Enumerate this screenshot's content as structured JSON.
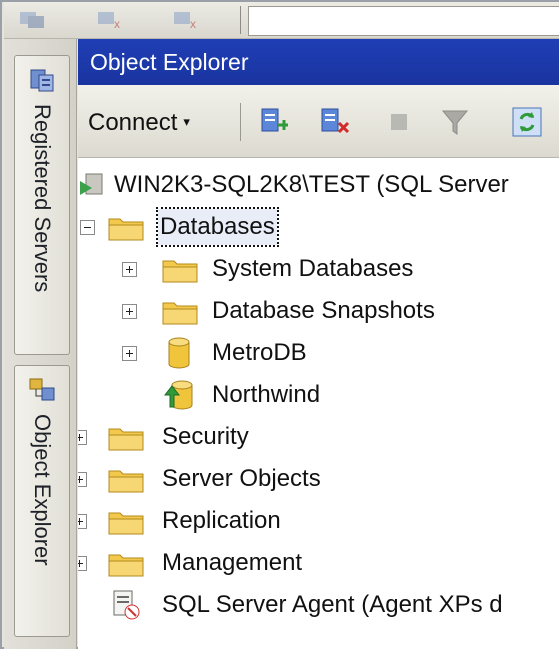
{
  "panel": {
    "title": "Object Explorer"
  },
  "side_tabs": [
    {
      "label": "Registered Servers"
    },
    {
      "label": "Object Explorer"
    }
  ],
  "toolbar": {
    "connect_label": "Connect",
    "connect_caret": "▾"
  },
  "tree": {
    "server": "WIN2K3-SQL2K8\\TEST (SQL Server",
    "databases": "Databases",
    "system_databases": "System Databases",
    "database_snapshots": "Database Snapshots",
    "metrodb": "MetroDB",
    "northwind": "Northwind",
    "security": "Security",
    "server_objects": "Server Objects",
    "replication": "Replication",
    "management": "Management",
    "sql_agent": "SQL Server Agent (Agent XPs d"
  },
  "colors": {
    "title_bar": "#1f3fb5",
    "folder": "#f2c94c",
    "server_green": "#3aa14a"
  }
}
